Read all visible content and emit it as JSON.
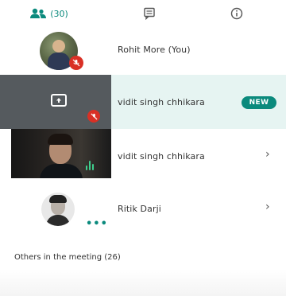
{
  "tabs": {
    "people": {
      "icon": "people-icon",
      "count": "(30)"
    },
    "chat": {
      "icon": "chat-icon"
    },
    "info": {
      "icon": "info-icon"
    }
  },
  "colors": {
    "accent": "#0b8a7d",
    "muted_red": "#d93025",
    "highlight_row": "#e6f4f2"
  },
  "participants": [
    {
      "name": "Rohit More (You)",
      "status": "mic-off"
    },
    {
      "name": "vidit singh chhikara",
      "status": "mic-off",
      "badge": "NEW",
      "presenting": true
    },
    {
      "name": "vidit singh chhikara",
      "status": "speaking"
    },
    {
      "name": "Ritik Darji",
      "status": "more"
    }
  ],
  "section": {
    "others_label": "Others in the meeting (26)"
  }
}
